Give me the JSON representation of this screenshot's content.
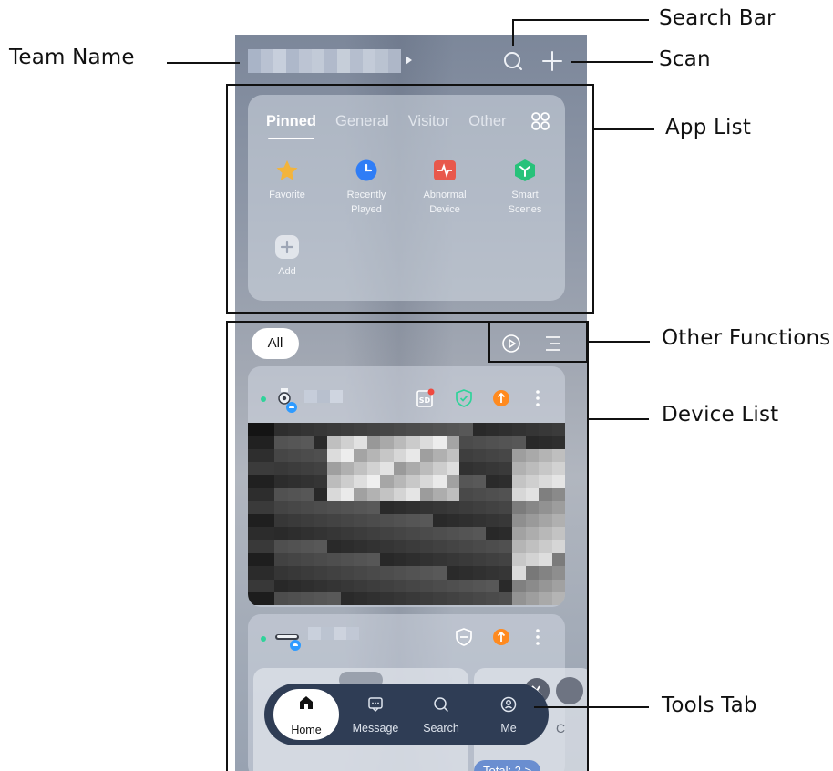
{
  "annotations": {
    "team_name": "Team Name",
    "search_bar": "Search Bar",
    "scan": "Scan",
    "app_list": "App List",
    "other_functions": "Other Functions",
    "device_list": "Device List",
    "tools_tab": "Tools Tab"
  },
  "app_list": {
    "tabs": [
      "Pinned",
      "General",
      "Visitor",
      "Other"
    ],
    "active_tab": "Pinned",
    "apps": [
      {
        "label_line1": "Favorite",
        "label_line2": "",
        "icon": "star-icon",
        "color": "#f3b43b"
      },
      {
        "label_line1": "Recently",
        "label_line2": "Played",
        "icon": "clock-icon",
        "color": "#2f7df6"
      },
      {
        "label_line1": "Abnormal",
        "label_line2": "Device",
        "icon": "pulse-icon",
        "color": "#e8584b"
      },
      {
        "label_line1": "Smart",
        "label_line2": "Scenes",
        "icon": "cube-icon",
        "color": "#27c27a"
      },
      {
        "label_line1": "Add",
        "label_line2": "",
        "icon": "plus-icon",
        "color": "#e9ecf1"
      }
    ]
  },
  "device_filter": {
    "label": "All"
  },
  "device_overflow": {
    "label": "C"
  },
  "tools_tab": {
    "items": [
      {
        "label": "Home",
        "icon": "home-icon"
      },
      {
        "label": "Message",
        "icon": "message-icon"
      },
      {
        "label": "Search",
        "icon": "search-icon"
      },
      {
        "label": "Me",
        "icon": "person-icon"
      }
    ],
    "active": "Home"
  },
  "device_summary": {
    "total": "Total: 2 >"
  },
  "colors": {
    "online": "#2fd39a",
    "cloud_badge": "#2f9bff",
    "tabbar_bg": "#2f3d55",
    "shield_green": "#2fd39a",
    "alert_orange": "#ff8a1f"
  }
}
